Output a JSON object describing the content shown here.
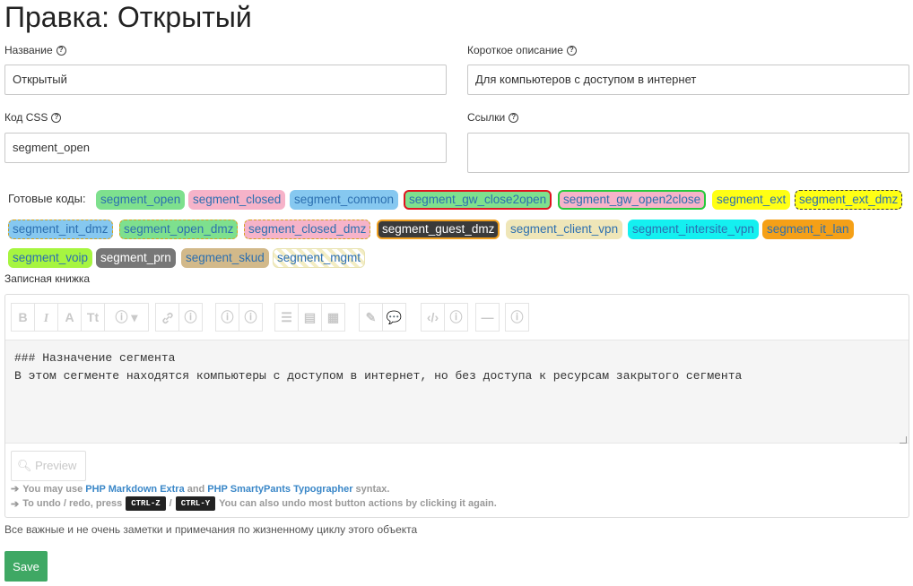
{
  "page": {
    "title": "Правка: Открытый"
  },
  "fields": {
    "name": {
      "label": "Название",
      "value": "Открытый"
    },
    "short_desc": {
      "label": "Короткое описание",
      "value": "Для компьютеров с доступом в интернет"
    },
    "css_code": {
      "label": "Код CSS",
      "value": "segment_open"
    },
    "links": {
      "label": "Ссылки",
      "value": ""
    }
  },
  "codes": {
    "label": "Готовые коды:",
    "items": [
      {
        "text": "segment_open",
        "bg": "#7ee08e",
        "fg": "#2c6fb0",
        "border": "#7ee08e",
        "style": "solid"
      },
      {
        "text": "segment_closed",
        "bg": "#f6b3c9",
        "fg": "#2c6fb0",
        "border": "#f6b3c9",
        "style": "solid"
      },
      {
        "text": "segment_common",
        "bg": "#86c8f0",
        "fg": "#2c6fb0",
        "border": "#86c8f0",
        "style": "solid"
      },
      {
        "text": "segment_gw_close2open",
        "bg": "#7ee08e",
        "fg": "#2c6fb0",
        "border": "#e0141e",
        "style": "solid-thick"
      },
      {
        "text": "segment_gw_open2close",
        "bg": "#f6b3c9",
        "fg": "#2c6fb0",
        "border": "#26c93a",
        "style": "solid-thick"
      },
      {
        "text": "segment_ext",
        "bg": "#ffff14",
        "fg": "#2c6fb0",
        "border": "#ffff14",
        "style": "solid"
      },
      {
        "text": "segment_ext_dmz",
        "bg": "#ffff14",
        "fg": "#2c6fb0",
        "border": "#333333",
        "style": "dashed"
      },
      {
        "text": "segment_int_dmz",
        "bg": "#86c8f0",
        "fg": "#2c6fb0",
        "border": "#d4a21a",
        "style": "dashed"
      },
      {
        "text": "segment_open_dmz",
        "bg": "#7ee08e",
        "fg": "#2c6fb0",
        "border": "#d4a21a",
        "style": "dashed"
      },
      {
        "text": "segment_closed_dmz",
        "bg": "#f6b3c9",
        "fg": "#2c6fb0",
        "border": "#d4a21a",
        "style": "dashed"
      },
      {
        "text": "segment_guest_dmz",
        "bg": "#3a3a3a",
        "fg": "#ffffff",
        "border": "#f0a020",
        "style": "solid-thick"
      },
      {
        "text": "segment_client_vpn",
        "bg": "#efe6b8",
        "fg": "#2c6fb0",
        "border": "#efe6b8",
        "style": "solid"
      },
      {
        "text": "segment_intersite_vpn",
        "bg": "#14f0f0",
        "fg": "#2c6fb0",
        "border": "#14f0f0",
        "style": "solid"
      },
      {
        "text": "segment_it_lan",
        "bg": "#f5a017",
        "fg": "#2c6fb0",
        "border": "#f5a017",
        "style": "solid"
      },
      {
        "text": "segment_voip",
        "bg": "#a6f540",
        "fg": "#2c6fb0",
        "border": "#a6f540",
        "style": "solid"
      },
      {
        "text": "segment_prn",
        "bg": "#777777",
        "fg": "#ffffff",
        "border": "#777777",
        "style": "solid"
      },
      {
        "text": "segment_skud",
        "bg": "#d2b98a",
        "fg": "#2c6fb0",
        "border": "#d2b98a",
        "style": "solid"
      },
      {
        "text": "segment_mgmt",
        "bg": "#ffffff",
        "fg": "#2c6fb0",
        "border": "#e8e2b0",
        "style": "striped"
      }
    ]
  },
  "notebook": {
    "label": "Записная книжка",
    "content": "### Назначение сегмента\nВ этом сегменте находятся компьютеры с доступом в интернет, но без доступа к ресурсам закрытого сегмента",
    "toolbar_icons": [
      "bold-icon",
      "italic-icon",
      "heading-icon",
      "text-size-icon",
      "info-dropdown-icon",
      "link-icon",
      "info-icon",
      "info-icon",
      "info-icon",
      "list-icon",
      "table-icon",
      "grid-icon",
      "edit-icon",
      "comment-icon",
      "code-icon",
      "info-icon",
      "hr-icon",
      "info-icon"
    ],
    "preview_label": "Preview",
    "hint1": {
      "prefix": "You may use",
      "link1": "PHP Markdown Extra",
      "mid": "and",
      "link2": "PHP SmartyPants Typographer",
      "suffix": "syntax."
    },
    "hint2": {
      "prefix": "To undo / redo, press",
      "key1": "CTRL-Z",
      "sep": "/",
      "key2": "CTRL-Y",
      "suffix": "You can also undo most button actions by clicking it again."
    },
    "help_text": "Все важные и не очень заметки и примечания по жизненному циклу этого объекта"
  },
  "actions": {
    "save_label": "Save"
  }
}
